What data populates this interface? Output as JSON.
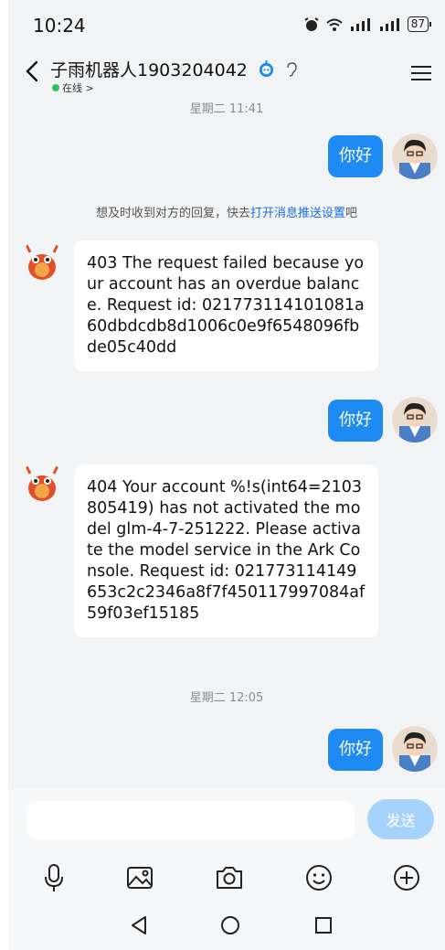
{
  "status": {
    "time": "10:24",
    "battery": "87"
  },
  "header": {
    "title": "子雨机器人1903204042",
    "presence": "在线 >"
  },
  "messages": {
    "ts1": "星期二 11:41",
    "out1": "你好",
    "notice_prefix": "想及时收到对方的回复，快去",
    "notice_link": "打开消息推送设置",
    "notice_suffix": "吧",
    "in1": "403 The request failed because your account has an overdue balance. Request id: 021773114101081a60dbdcdb8d1006c0e9f6548096fbde05c40dd",
    "out2": "你好",
    "in2": "404 Your account %!s(int64=2103805419) has not activated the model glm-4-7-251222. Please activate the model service in the Ark Console. Request id: 021773114149653c2c2346a8f7f450117997084af59f03ef15185",
    "ts2": "星期二 12:05",
    "out3": "你好"
  },
  "input": {
    "value": "",
    "send_label": "发送"
  },
  "icons": {
    "toolbar": [
      "microphone-icon",
      "image-icon",
      "camera-icon",
      "emoji-icon",
      "plus-icon"
    ],
    "nav": [
      "back-triangle-icon",
      "home-circle-icon",
      "recents-square-icon"
    ]
  },
  "colors": {
    "outgoing_bubble": "#1e8bf5",
    "send_button": "#a6d3fb",
    "link": "#1a6fe0",
    "online": "#2ec25c"
  }
}
